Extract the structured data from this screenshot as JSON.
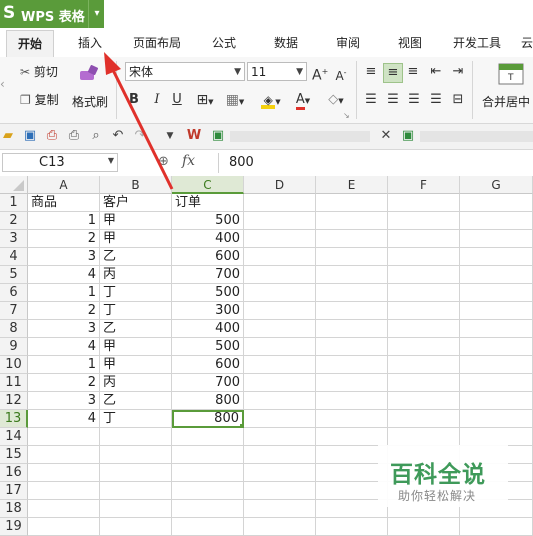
{
  "app": {
    "logo": "S",
    "name": "WPS 表格",
    "menu_arrow": "▾"
  },
  "tabs": [
    "开始",
    "插入",
    "页面布局",
    "公式",
    "数据",
    "审阅",
    "视图",
    "开发工具",
    "云"
  ],
  "active_tab": 0,
  "ribbon": {
    "cut": "剪切",
    "copy": "复制",
    "format_painter": "格式刷",
    "font_name": "宋体",
    "font_size": "11",
    "grow": "A",
    "shrink": "A",
    "bold": "B",
    "italic": "I",
    "underline": "U",
    "font_color_letter": "A",
    "merge_center": "合并居中"
  },
  "formula_bar": {
    "cell_ref": "C13",
    "fx": "fx",
    "value": "800"
  },
  "columns": [
    "A",
    "B",
    "C",
    "D",
    "E",
    "F",
    "G"
  ],
  "selected_col": "C",
  "selected_row": 13,
  "rows": [
    {
      "n": "1",
      "a": "商品",
      "b": "客户",
      "c": "订单"
    },
    {
      "n": "2",
      "a": "1",
      "b": "甲",
      "c": "500"
    },
    {
      "n": "3",
      "a": "2",
      "b": "甲",
      "c": "400"
    },
    {
      "n": "4",
      "a": "3",
      "b": "乙",
      "c": "600"
    },
    {
      "n": "5",
      "a": "4",
      "b": "丙",
      "c": "700"
    },
    {
      "n": "6",
      "a": "1",
      "b": "丁",
      "c": "500"
    },
    {
      "n": "7",
      "a": "2",
      "b": "丁",
      "c": "300"
    },
    {
      "n": "8",
      "a": "3",
      "b": "乙",
      "c": "400"
    },
    {
      "n": "9",
      "a": "4",
      "b": "甲",
      "c": "500"
    },
    {
      "n": "10",
      "a": "1",
      "b": "甲",
      "c": "600"
    },
    {
      "n": "11",
      "a": "2",
      "b": "丙",
      "c": "700"
    },
    {
      "n": "12",
      "a": "3",
      "b": "乙",
      "c": "800"
    },
    {
      "n": "13",
      "a": "4",
      "b": "丁",
      "c": "800"
    },
    {
      "n": "14",
      "a": "",
      "b": "",
      "c": ""
    },
    {
      "n": "15",
      "a": "",
      "b": "",
      "c": ""
    },
    {
      "n": "16",
      "a": "",
      "b": "",
      "c": ""
    },
    {
      "n": "17",
      "a": "",
      "b": "",
      "c": ""
    },
    {
      "n": "18",
      "a": "",
      "b": "",
      "c": ""
    },
    {
      "n": "19",
      "a": "",
      "b": "",
      "c": ""
    }
  ],
  "watermark": {
    "title": "百科全说",
    "subtitle": "助你轻松解决"
  },
  "colors": {
    "accent": "#5a9b3a",
    "arrow": "#e0312b"
  }
}
